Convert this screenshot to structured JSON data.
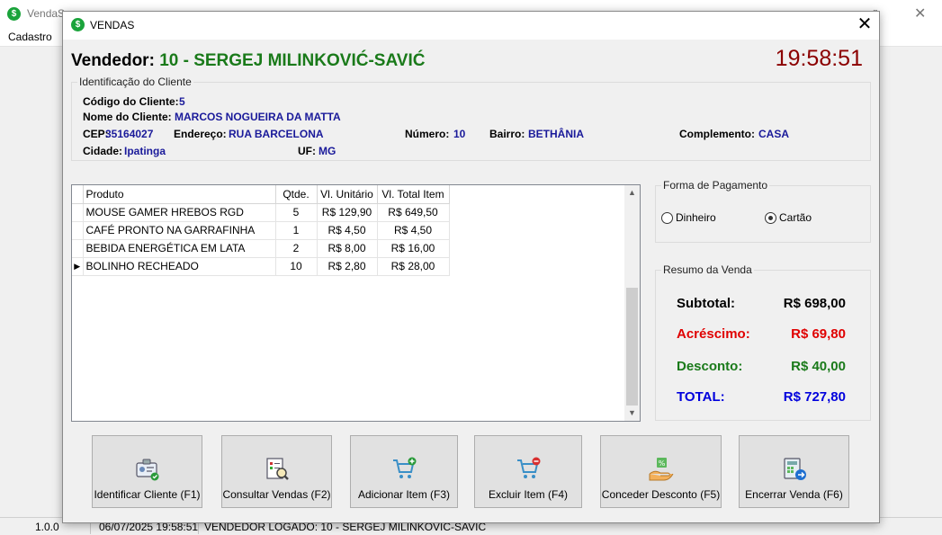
{
  "bg": {
    "title": "VendaS",
    "menu": "Cadastro",
    "status": {
      "version": "1.0.0",
      "datetime": "06/07/2025 19:58:51",
      "user": "VENDEDOR LOGADO:  10 - SERGEJ MILINKOVIC-SAVIC"
    }
  },
  "window": {
    "title": "VENDAS",
    "close": "✕",
    "icon": "$"
  },
  "header": {
    "vendedor_label": "Vendedor:",
    "vendedor_value": "10 - SERGEJ MILINKOVIĆ-SAVIĆ",
    "clock": "19:58:51"
  },
  "cliente": {
    "group_title": "Identificação do Cliente",
    "codigo_label": "Código do Cliente:",
    "codigo": "5",
    "nome_label": "Nome do Cliente:",
    "nome": "MARCOS NOGUEIRA DA MATTA",
    "cep_label": "CEP:",
    "cep": "35164027",
    "endereco_label": "Endereço:",
    "endereco": "RUA BARCELONA",
    "numero_label": "Número:",
    "numero": "10",
    "bairro_label": "Bairro:",
    "bairro": "BETHÂNIA",
    "complemento_label": "Complemento:",
    "complemento": "CASA",
    "cidade_label": "Cidade:",
    "cidade": "Ipatinga",
    "uf_label": "UF:",
    "uf": "MG"
  },
  "grid": {
    "columns": [
      "Produto",
      "Qtde.",
      "Vl. Unitário",
      "Vl. Total Item"
    ],
    "rows": [
      [
        "MOUSE GAMER HREBOS RGD",
        "5",
        "R$ 129,90",
        "R$ 649,50"
      ],
      [
        "CAFÉ PRONTO NA GARRAFINHA",
        "1",
        "R$ 4,50",
        "R$ 4,50"
      ],
      [
        "BEBIDA ENERGÉTICA EM LATA",
        "2",
        "R$ 8,00",
        "R$ 16,00"
      ],
      [
        "BOLINHO RECHEADO",
        "10",
        "R$ 2,80",
        "R$ 28,00"
      ]
    ],
    "current_row": 3
  },
  "pagamento": {
    "group_title": "Forma de Pagamento",
    "options": [
      "Dinheiro",
      "Cartão"
    ],
    "selected": "Cartão"
  },
  "resumo": {
    "group_title": "Resumo da Venda",
    "subtotal_label": "Subtotal:",
    "subtotal": "R$ 698,00",
    "acrescimo_label": "Acréscimo:",
    "acrescimo": "R$ 69,80",
    "desconto_label": "Desconto:",
    "desconto": "R$ 40,00",
    "total_label": "TOTAL:",
    "total": "R$ 727,80"
  },
  "buttons": [
    {
      "label": "Identificar Cliente (F1)",
      "icon": "id-card-icon"
    },
    {
      "label": "Consultar Vendas (F2)",
      "icon": "search-document-icon"
    },
    {
      "label": "Adicionar Item (F3)",
      "icon": "cart-add-icon"
    },
    {
      "label": "Excluir Item (F4)",
      "icon": "cart-remove-icon"
    },
    {
      "label": "Conceder Desconto (F5)",
      "icon": "discount-hand-icon"
    },
    {
      "label": "Encerrar Venda (F6)",
      "icon": "finish-sale-icon"
    }
  ],
  "colors": {
    "vendedor": "#1a7a1a",
    "clock": "#8b0000",
    "cliente_values": "#1a1a9a",
    "acrescimo": "#e00000",
    "desconto": "#1a7a1a",
    "total": "#0000dd"
  }
}
